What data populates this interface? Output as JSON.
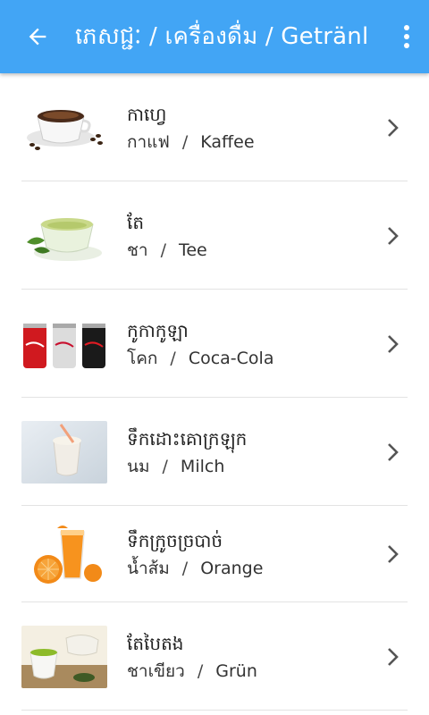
{
  "appbar": {
    "title": "ភេសជ្ជៈ / เครื่องดื่ม / Getränl",
    "back_icon": "arrow-back-icon",
    "menu_icon": "more-vert-icon",
    "background": "#42a5f5"
  },
  "items": [
    {
      "khmer": "កាហ្វេ",
      "thai": "กาแฟ",
      "separator": "/",
      "german": "Kaffee",
      "image": "coffee-cup"
    },
    {
      "khmer": "តែ",
      "thai": "ชา",
      "separator": "/",
      "german": "Tee",
      "image": "glass-tea-cup"
    },
    {
      "khmer": "កូកាកូឡា",
      "thai": "โคก",
      "separator": "/",
      "german": "Coca-Cola",
      "image": "cola-cans"
    },
    {
      "khmer": "ទឹកដោះគោក្រឡុក",
      "thai": "นม",
      "separator": "/",
      "german": "Milch",
      "image": "milkshake"
    },
    {
      "khmer": "ទឹកក្រូចច្របាច់",
      "thai": "น้ำส้ม",
      "separator": "/",
      "german": "Orange",
      "image": "orange-juice"
    },
    {
      "khmer": "តែបៃតង",
      "thai": "ชาเขียว",
      "separator": "/",
      "german": "Grün",
      "image": "green-tea"
    }
  ]
}
